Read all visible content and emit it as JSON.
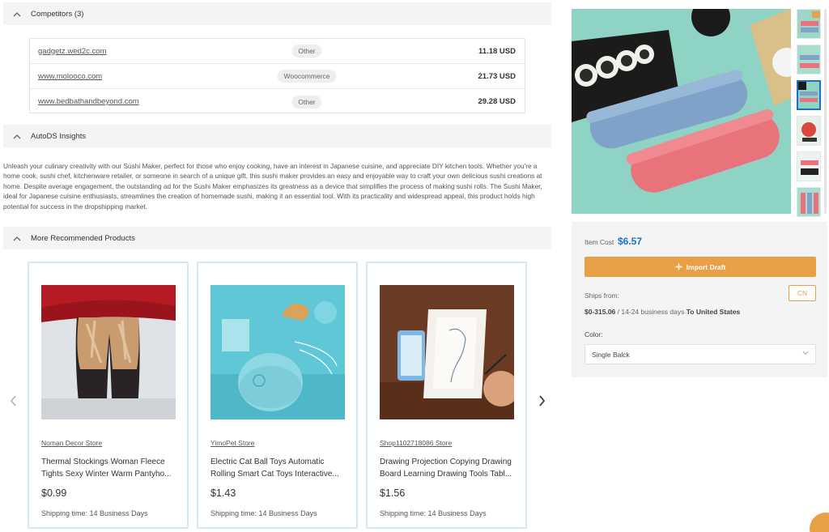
{
  "competitors": {
    "title": "Competitors (3)",
    "rows": [
      {
        "site": "gadgetz.wed2c.com",
        "platform": "Other",
        "price": "11.18 USD"
      },
      {
        "site": "www.molooco.com",
        "platform": "Woocommerce",
        "price": "21.73 USD"
      },
      {
        "site": "www.bedbathandbeyond.com",
        "platform": "Other",
        "price": "29.28 USD"
      }
    ]
  },
  "insights": {
    "title": "AutoDS Insights",
    "text": "Unleash your culinary creativity with our Sushi Maker, perfect for those who enjoy cooking, have an interest in Japanese cuisine, and appreciate DIY kitchen tools. Whether you're a home cook, sushi chef, kitchenware retailer, or someone in search of a unique gift, this sushi maker provides an easy and enjoyable way to craft your own delicious sushi creations at home. Despite average engagement, the outstanding ad for the Sushi Maker emphasizes its greatness as a device that simplifies the process of making sushi rolls. The Sushi Maker, ideal for Japanese cuisine enthusiasts, streamlines the creation of homemade sushi, making it an essential tool. With its practicality and widespread appeal, this product holds high potential for success in the dropshipping market."
  },
  "recommended": {
    "title": "More Recommended Products",
    "products": [
      {
        "store": "Noman Decor Store",
        "name_line1": "Thermal Stockings Woman Fleece",
        "name_line2": "Tights Sexy Winter Warm Pantyho...",
        "price": "$0.99",
        "shipping": "Shipping time: 14 Business Days"
      },
      {
        "store": "YimoPet Store",
        "name_line1": "Electric Cat Ball Toys Automatic",
        "name_line2": "Rolling Smart Cat Toys Interactive...",
        "price": "$1.43",
        "shipping": "Shipping time: 14 Business Days"
      },
      {
        "store": "Shop1102718086 Store",
        "name_line1": "Drawing Projection Copying Drawing",
        "name_line2": "Board Learning Drawing Tools Tabl...",
        "price": "$1.56",
        "shipping": "Shipping time: 14 Business Days"
      }
    ]
  },
  "product": {
    "item_cost_label": "Item Cost",
    "item_cost": "$6.57",
    "import_label": "Import Draft",
    "ships_from_label": "Ships from:",
    "origin": "CN",
    "shipping_price": "$0-315.06",
    "shipping_days": "/ 14-24 business days",
    "destination": "To United States",
    "color_label": "Color:",
    "color_value": "Single Balck"
  },
  "colors": {
    "accent": "#e8a047",
    "link_blue": "#1e6fc8",
    "card_border": "#d5e7f7"
  }
}
